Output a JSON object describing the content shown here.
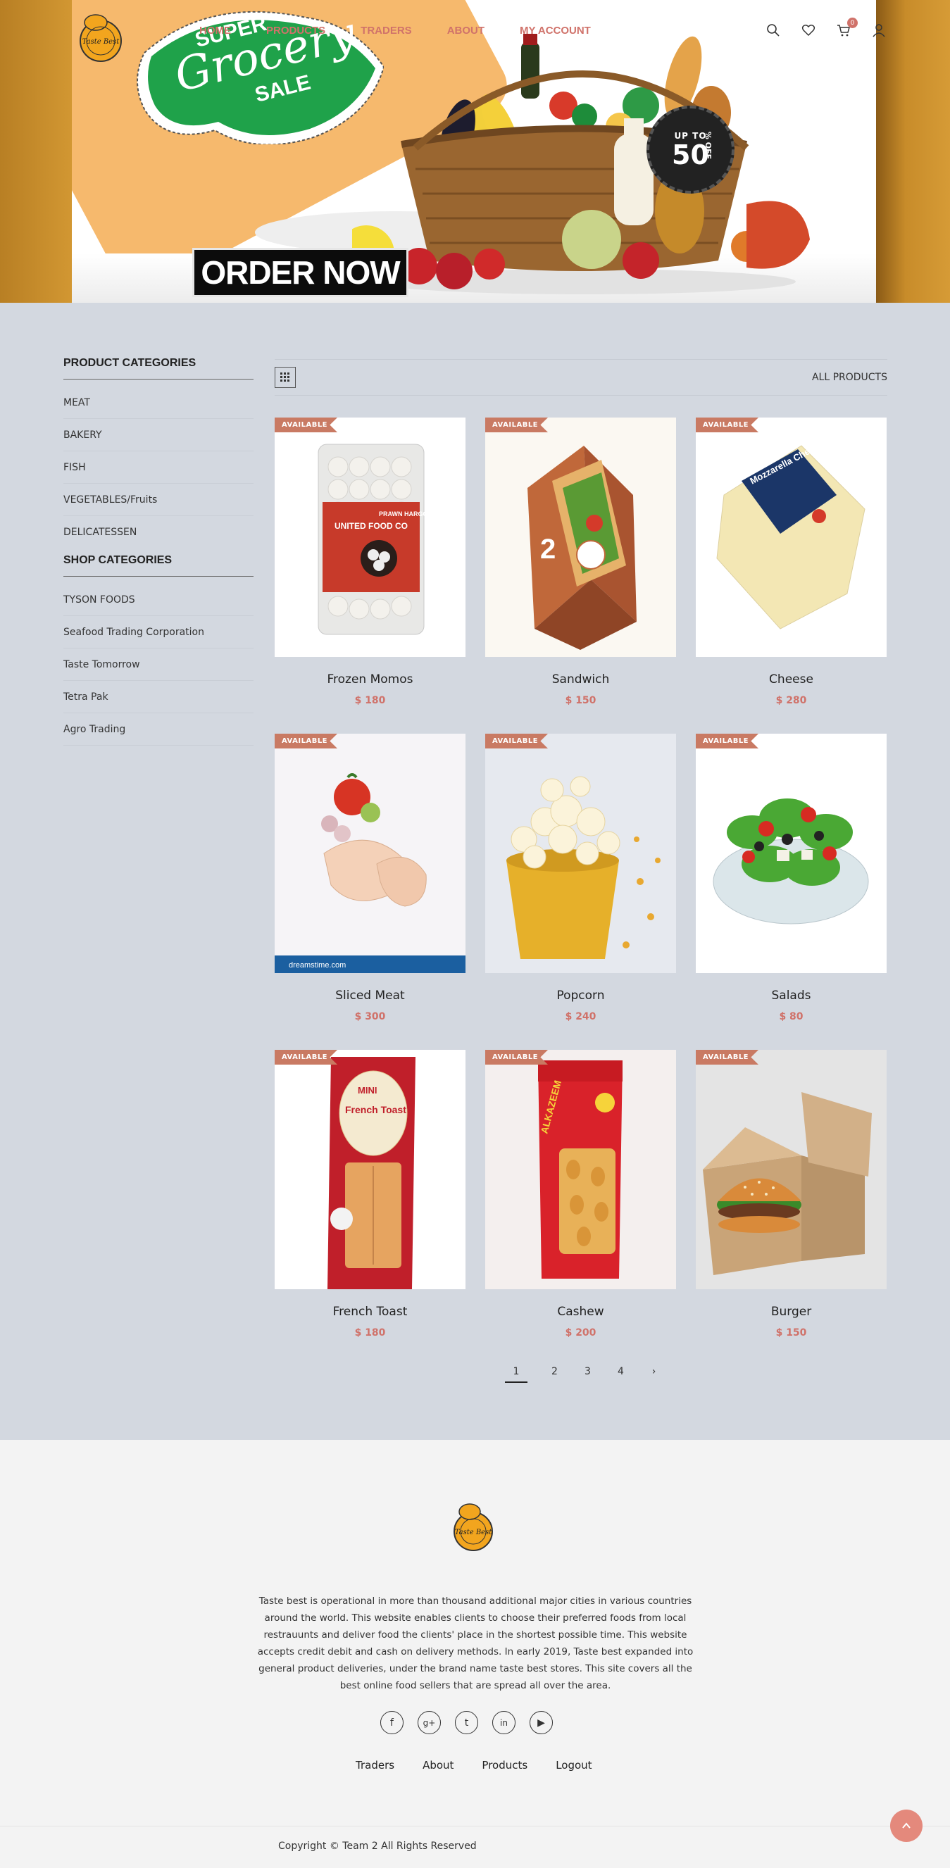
{
  "nav": {
    "items": [
      "HOME",
      "PRODUCTS",
      "TRADERS",
      "ABOUT",
      "MY ACCOUNT"
    ],
    "cart_count": "0",
    "logo_text": "Taste Best"
  },
  "hero": {
    "sticker_top": "SUPER",
    "sticker_mid": "Grocery",
    "sticker_bottom": "SALE",
    "badge_top": "UP TO",
    "badge_value": "50",
    "badge_suffix": "% OFF",
    "order_button": "ORDER NOW"
  },
  "sidebar": {
    "product_categories_title": "PRODUCT CATEGORIES",
    "product_categories": [
      "MEAT",
      "BAKERY",
      "FISH",
      "VEGETABLES/Fruits",
      "DELICATESSEN"
    ],
    "shop_categories_title": "SHOP CATEGORIES",
    "shop_categories": [
      "TYSON FOODS",
      "Seafood Trading Corporation",
      "Taste Tomorrow",
      "Tetra Pak",
      "Agro Trading"
    ]
  },
  "toolbar": {
    "all_products": "ALL PRODUCTS"
  },
  "products": [
    {
      "name": "Frozen Momos",
      "price": "$ 180",
      "tag": "AVAILABLE",
      "icon": "frozen-momos-image"
    },
    {
      "name": "Sandwich",
      "price": "$ 150",
      "tag": "AVAILABLE",
      "icon": "sandwich-image"
    },
    {
      "name": "Cheese",
      "price": "$ 280",
      "tag": "AVAILABLE",
      "icon": "cheese-image"
    },
    {
      "name": "Sliced Meat",
      "price": "$ 300",
      "tag": "AVAILABLE",
      "icon": "sliced-meat-image"
    },
    {
      "name": "Popcorn",
      "price": "$ 240",
      "tag": "AVAILABLE",
      "icon": "popcorn-image"
    },
    {
      "name": "Salads",
      "price": "$ 80",
      "tag": "AVAILABLE",
      "icon": "salad-image"
    },
    {
      "name": "French Toast",
      "price": "$ 180",
      "tag": "AVAILABLE",
      "icon": "french-toast-image"
    },
    {
      "name": "Cashew",
      "price": "$ 200",
      "tag": "AVAILABLE",
      "icon": "cashew-image"
    },
    {
      "name": "Burger",
      "price": "$ 150",
      "tag": "AVAILABLE",
      "icon": "burger-image"
    }
  ],
  "product_image_text": {
    "momos_brand": "UNITED FOOD CO",
    "momos_label": "PRAWN HARGOW",
    "cheese_label": "Mozzarella Cheese",
    "meat_watermark": "dreamstime.com",
    "toast_label_1": "MINI",
    "toast_label_2": "French Toast",
    "cashew_label": "ALKAZEEM"
  },
  "pagination": {
    "pages": [
      "1",
      "2",
      "3",
      "4"
    ],
    "next": "›"
  },
  "footer": {
    "about": "Taste best is operational in more than thousand additional major cities in various countries around the world. This website enables clients to choose their preferred foods from local restrauunts and deliver food the clients' place in the shortest possible time. This website accepts credit debit and cash on delivery methods. In early 2019, Taste best expanded into general product deliveries, under the brand name taste best stores. This site covers all the best online food sellers that are spread all over the area.",
    "socials": [
      "facebook-icon",
      "google-plus-icon",
      "tumblr-icon",
      "linkedin-icon",
      "youtube-icon"
    ],
    "links": [
      "Traders",
      "About",
      "Products",
      "Logout"
    ],
    "copyright": "Copyright © Team 2 All Rights Reserved"
  },
  "colors": {
    "accent": "#d0726a",
    "tag": "#c97a63",
    "page_bg": "#d3d8e0",
    "footer_bg": "#f3f3f3"
  }
}
